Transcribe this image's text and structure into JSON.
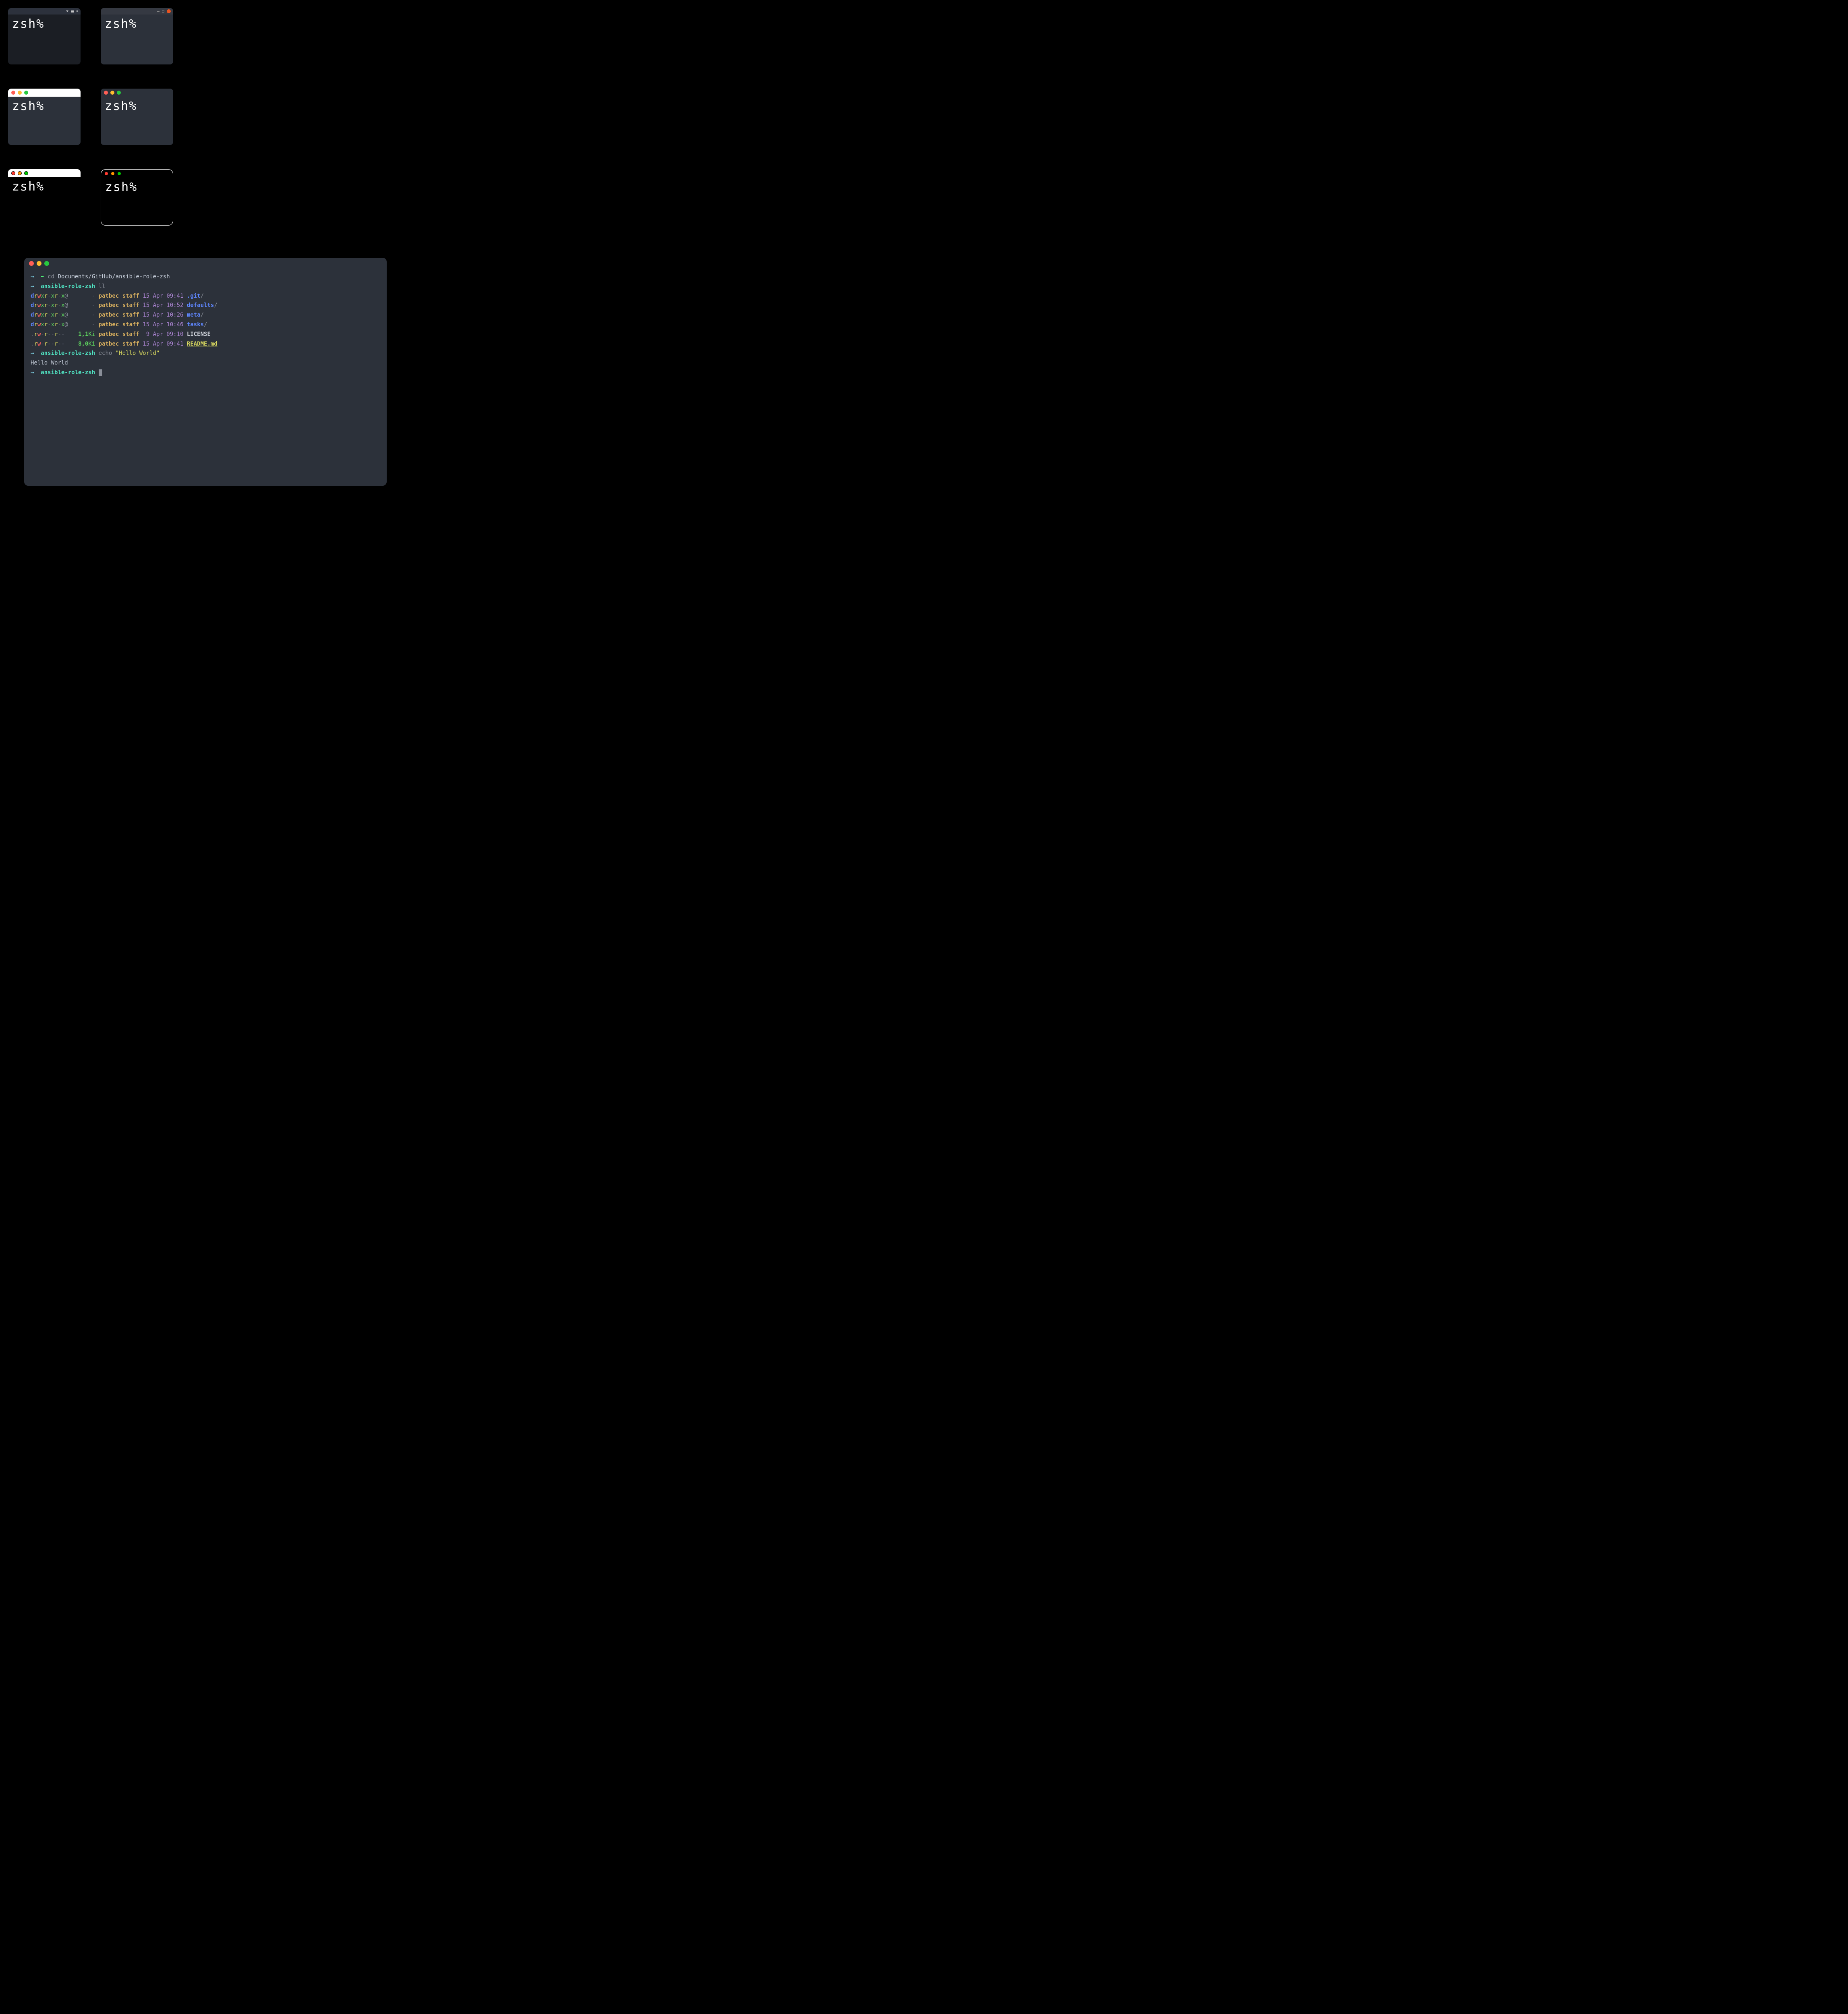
{
  "prompt": "zsh%",
  "terminal": {
    "line1": {
      "arrow": "→",
      "tilde": "~",
      "cmd": "cd",
      "path": "Documents/GitHub/ansible-role-zsh"
    },
    "line2": {
      "arrow": "→",
      "dir": "ansible-role-zsh",
      "cmd": "ll"
    },
    "listing": [
      {
        "perms": "drwxr-xr-x@",
        "size": "-",
        "user": "patbec",
        "group": "staff",
        "date": "15 Apr 09:41",
        "name": ".git",
        "suffix": "/",
        "type": "dir"
      },
      {
        "perms": "drwxr-xr-x@",
        "size": "-",
        "user": "patbec",
        "group": "staff",
        "date": "15 Apr 10:52",
        "name": "defaults",
        "suffix": "/",
        "type": "dir"
      },
      {
        "perms": "drwxr-xr-x@",
        "size": "-",
        "user": "patbec",
        "group": "staff",
        "date": "15 Apr 10:26",
        "name": "meta",
        "suffix": "/",
        "type": "dir"
      },
      {
        "perms": "drwxr-xr-x@",
        "size": "-",
        "user": "patbec",
        "group": "staff",
        "date": "15 Apr 10:46",
        "name": "tasks",
        "suffix": "/",
        "type": "dir"
      },
      {
        "perms": ".rw-r--r--",
        "size": "1,1Ki",
        "user": "patbec",
        "group": "staff",
        "date": " 9 Apr 09:10",
        "name": "LICENSE",
        "suffix": "",
        "type": "file"
      },
      {
        "perms": ".rw-r--r--",
        "size": "8,0Ki",
        "user": "patbec",
        "group": "staff",
        "date": "15 Apr 09:41",
        "name": "README.md",
        "suffix": "",
        "type": "readme"
      }
    ],
    "line_echo": {
      "arrow": "→",
      "dir": "ansible-role-zsh",
      "cmd": "echo",
      "arg": "\"Hello World\""
    },
    "output": "Hello World",
    "line_empty": {
      "arrow": "→",
      "dir": "ansible-role-zsh"
    }
  }
}
